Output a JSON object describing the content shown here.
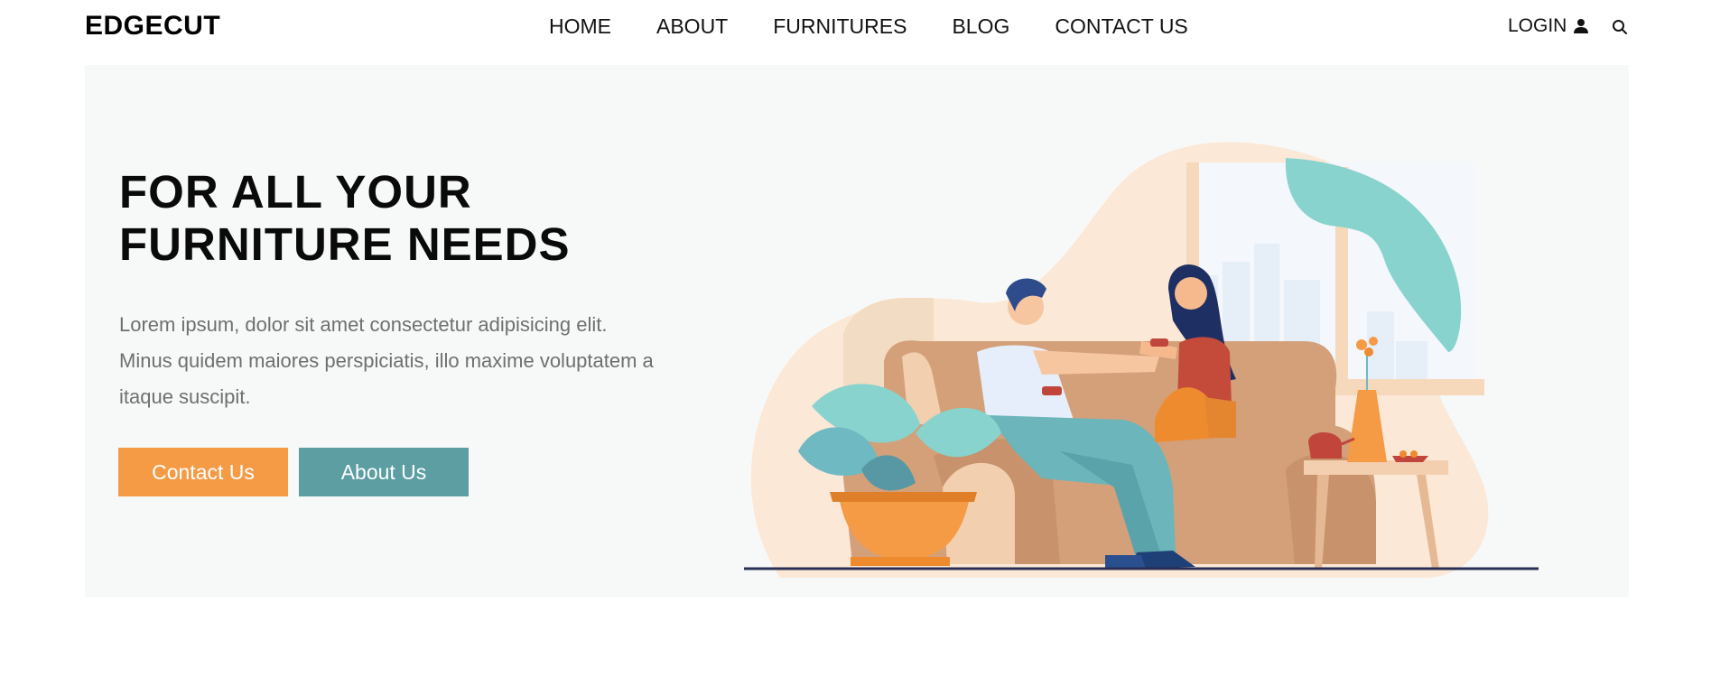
{
  "brand": {
    "name": "EDGECUT"
  },
  "nav": {
    "items": [
      {
        "label": "HOME"
      },
      {
        "label": "ABOUT"
      },
      {
        "label": "FURNITURES"
      },
      {
        "label": "BLOG"
      },
      {
        "label": "CONTACT US"
      }
    ]
  },
  "header": {
    "login_label": "LOGIN",
    "login_icon": "user-icon",
    "search_icon": "search-icon"
  },
  "hero": {
    "title_line1": "FOR ALL YOUR",
    "title_line2": "FURNITURE NEEDS",
    "text": "Lorem ipsum, dolor sit amet consectetur adipisicing elit. Minus quidem maiores perspiciatis, illo maxime voluptatem a itaque suscipit.",
    "buttons": {
      "contact_label": "Contact Us",
      "about_label": "About Us"
    }
  },
  "colors": {
    "accent_orange": "#f59a45",
    "accent_teal": "#5c9ea2",
    "hero_bg": "#f7f9f9",
    "text_muted": "#6f6f6f"
  }
}
